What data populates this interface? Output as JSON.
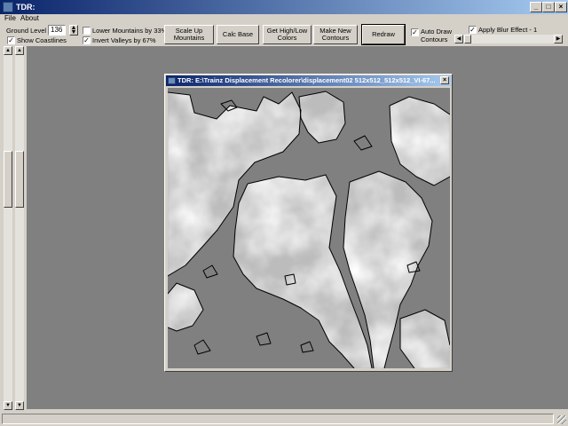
{
  "window": {
    "title": "TDR:"
  },
  "menu": [
    {
      "label": "File"
    },
    {
      "label": "About"
    }
  ],
  "toolbar": {
    "ground_level_label": "Ground Level",
    "ground_level_value": "136",
    "show_coastlines_label": "Show Coastlines",
    "show_coastlines_checked": true,
    "lower_mountains_label": "Lower Mountains by 33%",
    "lower_mountains_checked": false,
    "invert_valleys_label": "Invert Valleys by 67%",
    "invert_valleys_checked": true,
    "scale_up_label": "Scale Up Mountains",
    "calc_base_label": "Calc Base",
    "get_highlow_label": "Get High/Low Colors",
    "make_contours_label": "Make New Contours",
    "redraw_label": "Redraw",
    "auto_draw_label": "Auto Draw Contours",
    "auto_draw_checked": true,
    "apply_blur_label": "Apply Blur Effect - 1",
    "apply_blur_checked": true
  },
  "child_window": {
    "title": "TDR: E:\\Trainz Displacement Recolorer\\displacement02 512x512_512x512_VI-67..."
  },
  "icons": {
    "minimize": "minimize-icon",
    "maximize": "maximize-icon",
    "close": "close-icon"
  },
  "colors": {
    "title_active": "#0a246a",
    "title_gradient_end": "#a6caf0",
    "face": "#d4d0c8",
    "workspace": "#808080",
    "map_low": "#808080",
    "map_high": "#ffffff"
  }
}
